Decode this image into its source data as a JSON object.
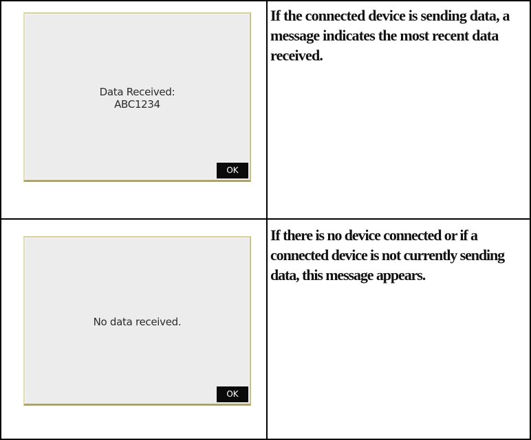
{
  "rows": [
    {
      "screen_message": "Data Received:\nABC1234",
      "ok_label": "OK",
      "description": "If the connected device is sending data, a message indicates the most recent data received."
    },
    {
      "screen_message": "No data received.",
      "ok_label": "OK",
      "description": "If there is no device connected or if a connected device is not currently sending data, this message appears."
    }
  ]
}
